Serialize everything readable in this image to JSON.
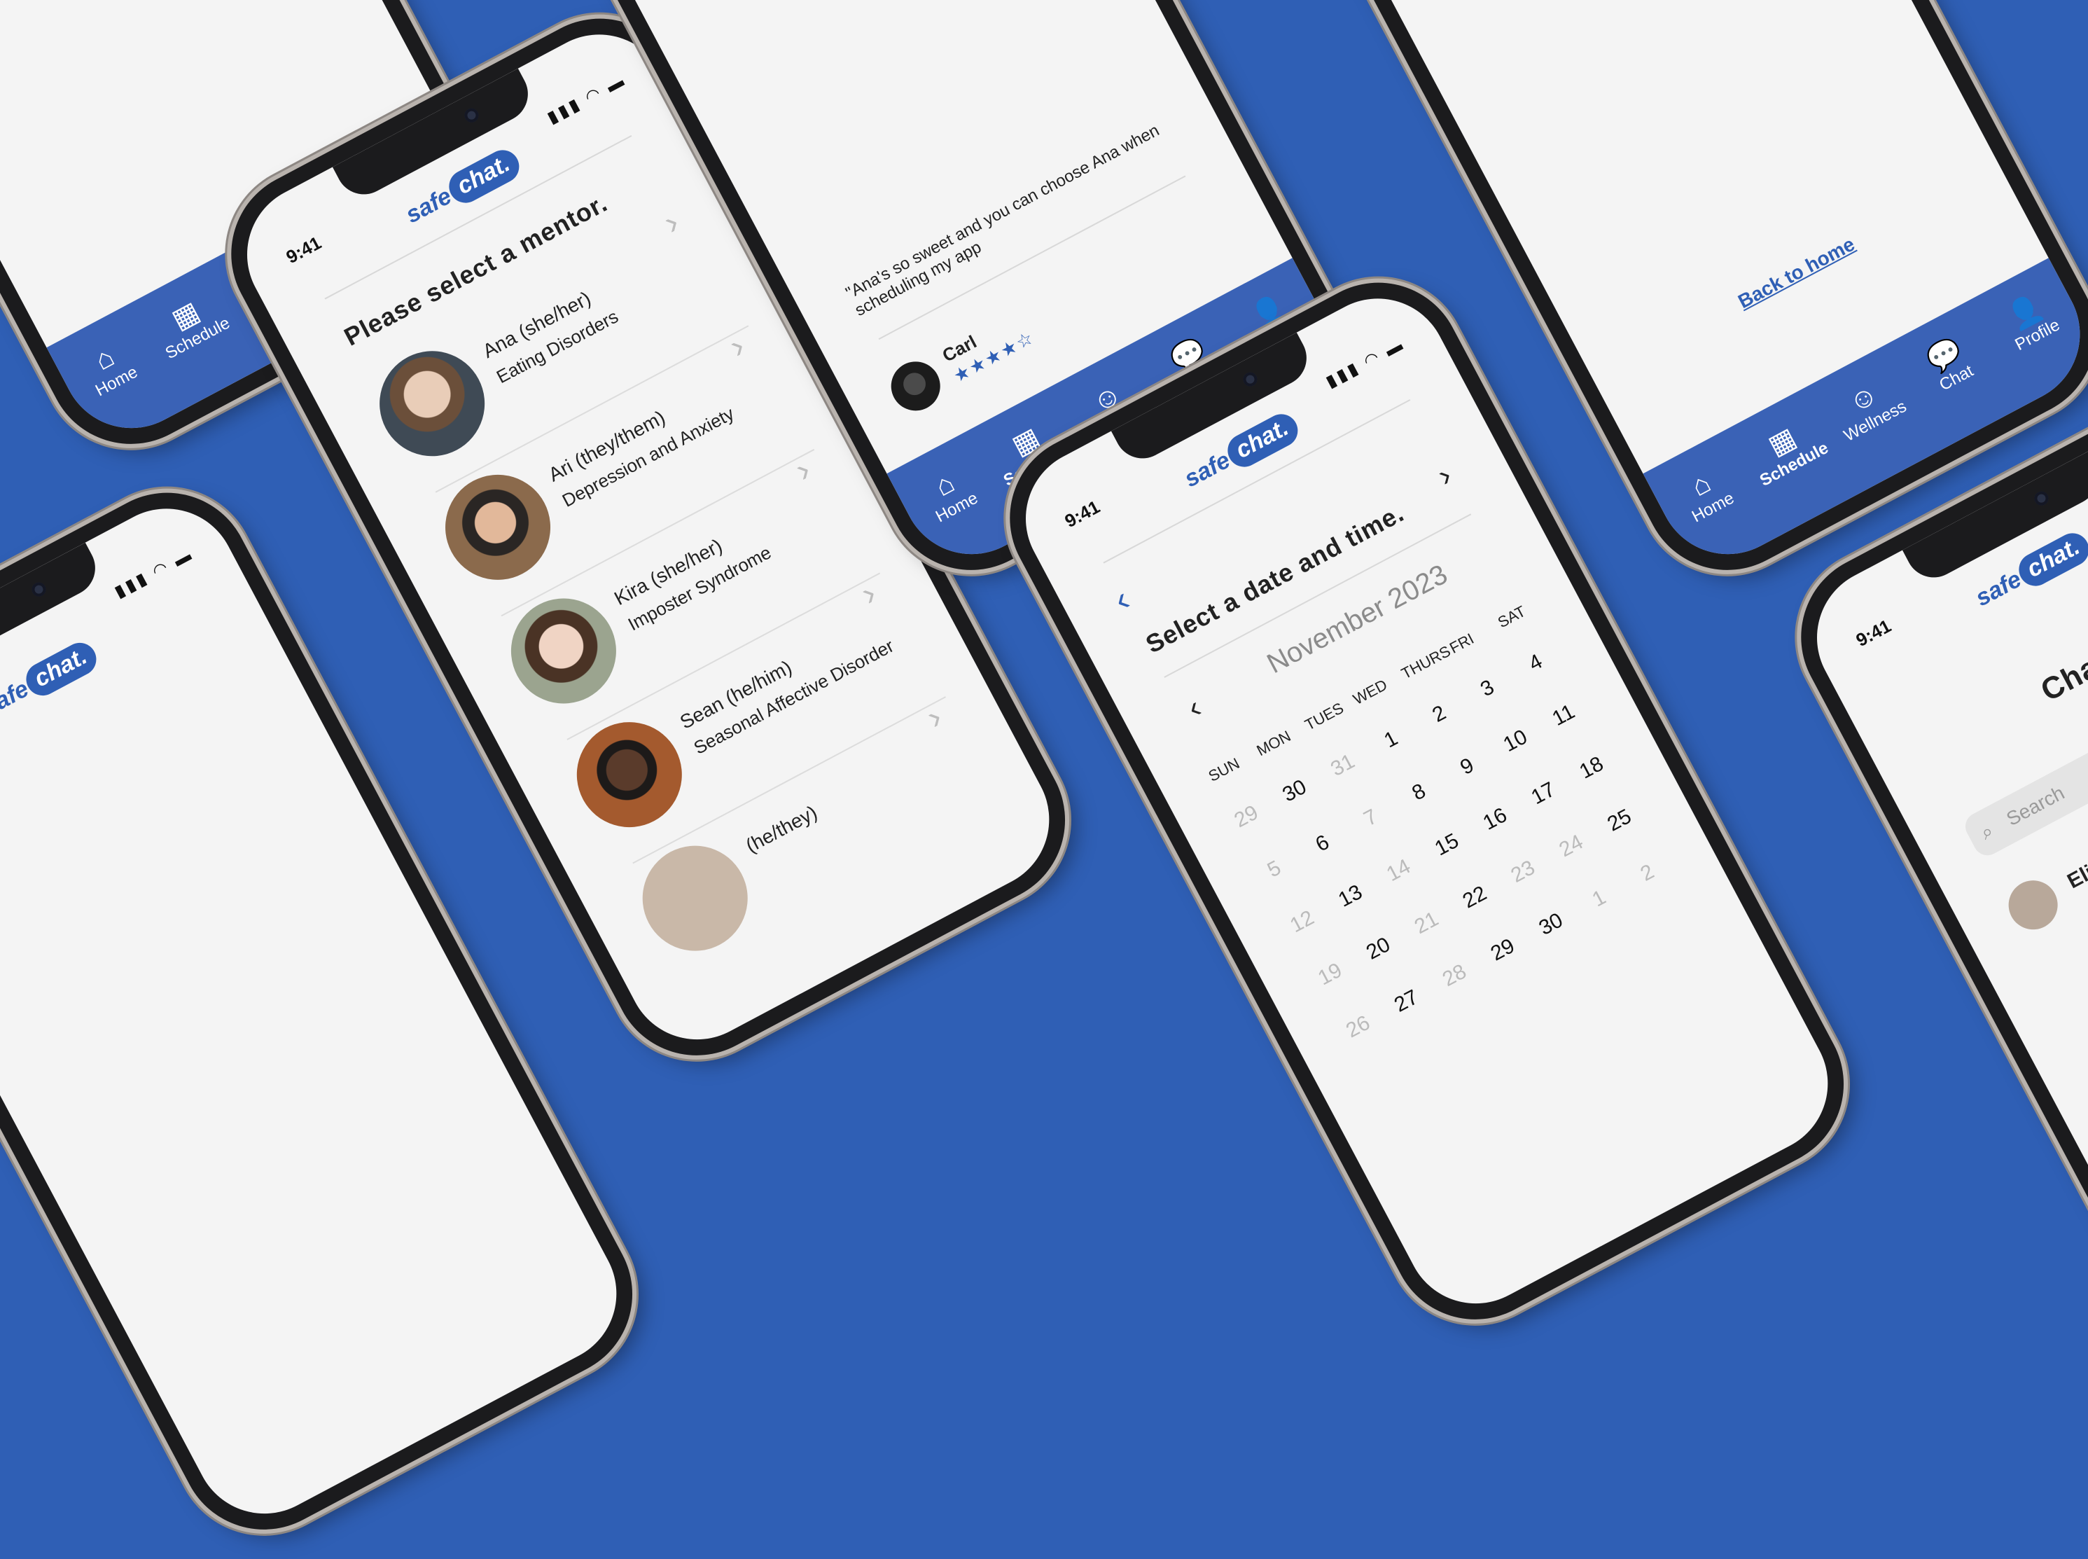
{
  "brand": {
    "word": "safe",
    "bubble": "chat."
  },
  "status": {
    "time": "9:41",
    "signal": "▮▮▮ ◠ ▬"
  },
  "tabs": {
    "home": "Home",
    "schedule": "Schedule",
    "wellness": "Wellness",
    "chat": "Chat",
    "profile": "Profile"
  },
  "mentor_screen": {
    "title": "Please select a mentor.",
    "mentors": [
      {
        "name": "Ana (she/her)",
        "topic": "Eating Disorders"
      },
      {
        "name": "Ari (they/them)",
        "topic": "Depression and Anxiety"
      },
      {
        "name": "Kira (she/her)",
        "topic": "Imposter Syndrome"
      },
      {
        "name": "Sean (he/him)",
        "topic": "Seasonal Affective Disorder"
      },
      {
        "name": "(he/they)",
        "topic": ""
      }
    ]
  },
  "review_screen": {
    "review_text": "\"Ana's so sweet and you can choose Ana when scheduling my app",
    "reviewer": "Carl",
    "stars": "★★★★☆"
  },
  "calendar_screen": {
    "title": "Select a date and time.",
    "month": "November 2023",
    "day_headers": [
      "SUN",
      "MON",
      "TUES",
      "WED",
      "THURS",
      "FRI",
      "SAT"
    ],
    "weeks": [
      [
        {
          "d": "29",
          "g": true
        },
        {
          "d": "30",
          "g": false
        },
        {
          "d": "31",
          "g": true
        },
        {
          "d": "1",
          "g": false
        },
        {
          "d": "2",
          "g": false
        },
        {
          "d": "3",
          "g": false
        },
        {
          "d": "4",
          "g": false
        }
      ],
      [
        {
          "d": "5",
          "g": true
        },
        {
          "d": "6",
          "g": false
        },
        {
          "d": "7",
          "g": true
        },
        {
          "d": "8",
          "g": false
        },
        {
          "d": "9",
          "g": false
        },
        {
          "d": "10",
          "g": false
        },
        {
          "d": "11",
          "g": false
        }
      ],
      [
        {
          "d": "12",
          "g": true
        },
        {
          "d": "13",
          "g": false
        },
        {
          "d": "14",
          "g": true
        },
        {
          "d": "15",
          "g": false
        },
        {
          "d": "16",
          "g": false
        },
        {
          "d": "17",
          "g": false
        },
        {
          "d": "18",
          "g": false
        }
      ],
      [
        {
          "d": "19",
          "g": true
        },
        {
          "d": "20",
          "g": false
        },
        {
          "d": "21",
          "g": true
        },
        {
          "d": "22",
          "g": false
        },
        {
          "d": "23",
          "g": true
        },
        {
          "d": "24",
          "g": true
        },
        {
          "d": "25",
          "g": false
        }
      ],
      [
        {
          "d": "26",
          "g": true
        },
        {
          "d": "27",
          "g": false
        },
        {
          "d": "28",
          "g": true
        },
        {
          "d": "29",
          "g": false
        },
        {
          "d": "30",
          "g": false
        },
        {
          "d": "1",
          "g": true
        },
        {
          "d": "2",
          "g": true
        }
      ]
    ]
  },
  "done_screen": {
    "link": "Back to home"
  },
  "chat_screen": {
    "title": "Chats",
    "search_placeholder": "Search",
    "first_contact": "Elizabeth"
  }
}
